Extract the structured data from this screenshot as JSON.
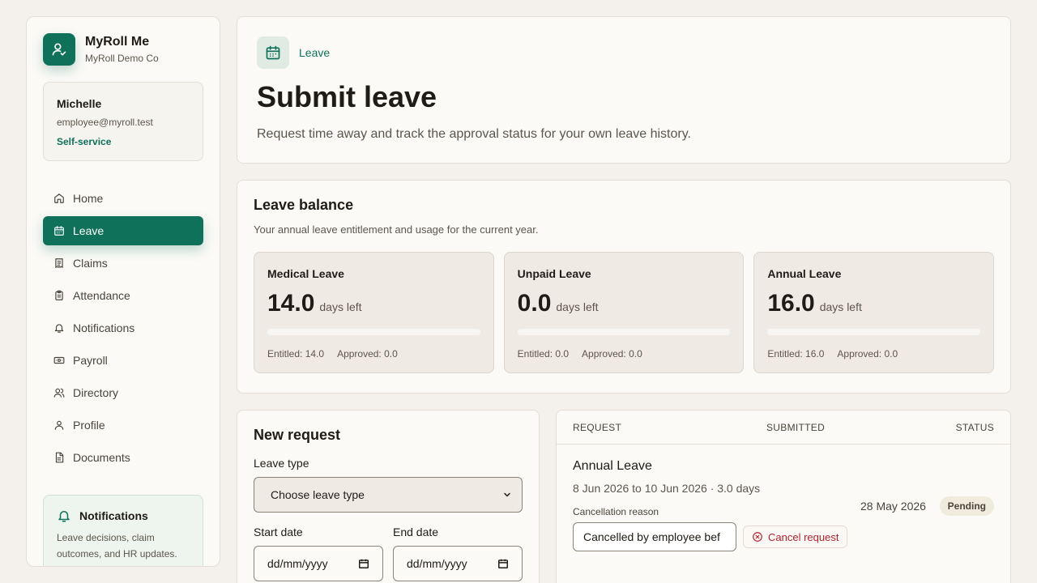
{
  "brand": {
    "name": "MyRoll Me",
    "company": "MyRoll Demo Co",
    "accent": "#0f7159"
  },
  "user": {
    "name": "Michelle",
    "email": "employee@myroll.test",
    "role": "Self-service"
  },
  "nav": [
    {
      "label": "Home",
      "icon": "home-icon",
      "active": false
    },
    {
      "label": "Leave",
      "icon": "calendar-icon",
      "active": true
    },
    {
      "label": "Claims",
      "icon": "receipt-icon",
      "active": false
    },
    {
      "label": "Attendance",
      "icon": "clipboard-icon",
      "active": false
    },
    {
      "label": "Notifications",
      "icon": "bell-icon",
      "active": false
    },
    {
      "label": "Payroll",
      "icon": "banknote-icon",
      "active": false
    },
    {
      "label": "Directory",
      "icon": "users-icon",
      "active": false
    },
    {
      "label": "Profile",
      "icon": "user-icon",
      "active": false
    },
    {
      "label": "Documents",
      "icon": "document-icon",
      "active": false
    }
  ],
  "notification_card": {
    "title": "Notifications",
    "text": "Leave decisions, claim outcomes, and HR updates."
  },
  "header": {
    "breadcrumb": "Leave",
    "title": "Submit leave",
    "subtitle": "Request time away and track the approval status for your own leave history."
  },
  "balance": {
    "title": "Leave balance",
    "subtitle": "Your annual leave entitlement and usage for the current year.",
    "unit": "days left",
    "items": [
      {
        "name": "Medical Leave",
        "value": "14.0",
        "entitled": "Entitled: 14.0",
        "approved": "Approved: 0.0",
        "used_fraction": 0
      },
      {
        "name": "Unpaid Leave",
        "value": "0.0",
        "entitled": "Entitled: 0.0",
        "approved": "Approved: 0.0",
        "used_fraction": 0
      },
      {
        "name": "Annual Leave",
        "value": "16.0",
        "entitled": "Entitled: 16.0",
        "approved": "Approved: 0.0",
        "used_fraction": 0
      }
    ]
  },
  "new_request": {
    "title": "New request",
    "leave_type_label": "Leave type",
    "leave_type_value": "Choose leave type",
    "start_label": "Start date",
    "end_label": "End date",
    "date_placeholder": "dd/mm/yyyy"
  },
  "history": {
    "columns": {
      "request": "REQUEST",
      "submitted": "SUBMITTED",
      "status": "STATUS"
    },
    "rows": [
      {
        "type": "Annual Leave",
        "dates": "8 Jun 2026 to 10 Jun 2026 · 3.0 days",
        "cancel_label": "Cancellation reason",
        "cancel_value": "Cancelled by employee bef",
        "cancel_button": "Cancel request",
        "submitted": "28 May 2026",
        "status": "Pending"
      }
    ]
  }
}
